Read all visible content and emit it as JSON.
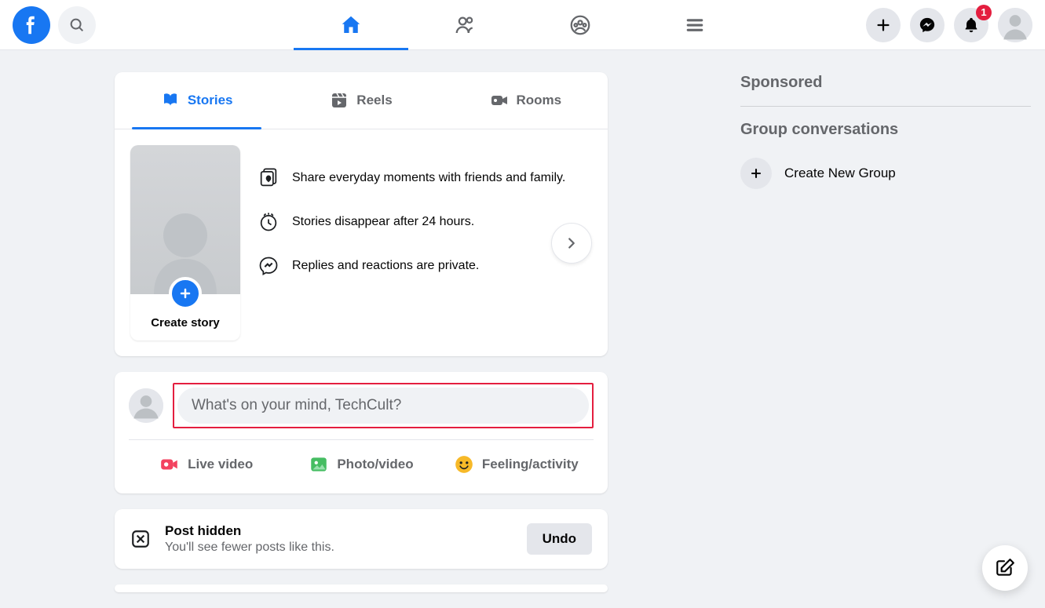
{
  "header": {
    "notification_count": "1"
  },
  "storyTabs": {
    "stories": "Stories",
    "reels": "Reels",
    "rooms": "Rooms"
  },
  "storyCard": {
    "create_label": "Create story",
    "info1": "Share everyday moments with friends and family.",
    "info2": "Stories disappear after 24 hours.",
    "info3": "Replies and reactions are private."
  },
  "composer": {
    "placeholder": "What's on your mind, TechCult?",
    "live_video": "Live video",
    "photo_video": "Photo/video",
    "feeling": "Feeling/activity"
  },
  "hiddenPost": {
    "title": "Post hidden",
    "desc": "You'll see fewer posts like this.",
    "undo": "Undo"
  },
  "rightRail": {
    "sponsored": "Sponsored",
    "group_conversations": "Group conversations",
    "create_group": "Create New Group"
  }
}
